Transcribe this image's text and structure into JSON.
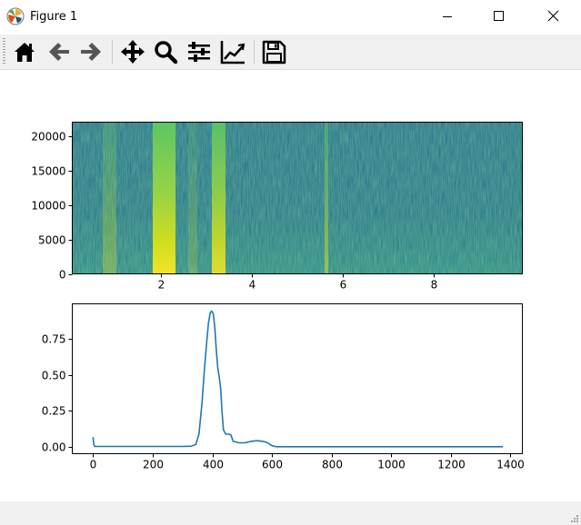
{
  "window": {
    "title": "Figure 1"
  },
  "toolbar": {
    "buttons": [
      {
        "id": "home",
        "icon": "home-icon"
      },
      {
        "id": "back",
        "icon": "arrow-left-icon"
      },
      {
        "id": "forward",
        "icon": "arrow-right-icon"
      },
      {
        "id": "pan",
        "icon": "move-icon"
      },
      {
        "id": "zoom",
        "icon": "magnifier-icon"
      },
      {
        "id": "subplots",
        "icon": "sliders-icon"
      },
      {
        "id": "customize",
        "icon": "line-chart-icon"
      },
      {
        "id": "save",
        "icon": "floppy-disk-icon"
      }
    ]
  },
  "colors": {
    "plot_line": "#1f77b4",
    "spec_bg": "#2a788e",
    "spec_hot": "#fde725"
  },
  "chart_data": [
    {
      "type": "heatmap",
      "xlim": [
        0.05,
        9.95
      ],
      "ylim": [
        0,
        22000
      ],
      "xticks": [
        2,
        4,
        6,
        8
      ],
      "xtick_labels": [
        "2",
        "4",
        "6",
        "8"
      ],
      "yticks": [
        0,
        5000,
        10000,
        15000,
        20000
      ],
      "ytick_labels": [
        "0",
        "5000",
        "10000",
        "15000",
        "20000"
      ],
      "colormap": "viridis",
      "bands": [
        {
          "x0": 1.82,
          "x1": 2.32,
          "intensity": 0.95
        },
        {
          "x0": 3.12,
          "x1": 3.42,
          "intensity": 0.85
        },
        {
          "x0": 5.6,
          "x1": 5.68,
          "intensity": 0.45
        },
        {
          "x0": 0.72,
          "x1": 1.02,
          "intensity": 0.3
        },
        {
          "x0": 2.6,
          "x1": 2.8,
          "intensity": 0.2
        }
      ]
    },
    {
      "type": "line",
      "xlim": [
        -70,
        1440
      ],
      "ylim": [
        -0.045,
        0.99
      ],
      "xticks": [
        0,
        200,
        400,
        600,
        800,
        1000,
        1200,
        1400
      ],
      "xtick_labels": [
        "0",
        "200",
        "400",
        "600",
        "800",
        "1000",
        "1200",
        "1400"
      ],
      "yticks": [
        0.0,
        0.25,
        0.5,
        0.75
      ],
      "ytick_labels": [
        "0.00",
        "0.25",
        "0.50",
        "0.75"
      ],
      "grid": false,
      "series": [
        {
          "x": [
            0,
            2,
            5,
            10,
            50,
            100,
            200,
            300,
            330,
            345,
            355,
            365,
            372,
            380,
            387,
            393,
            398,
            403,
            408,
            413,
            418,
            424,
            428,
            432,
            437,
            445,
            455,
            462,
            470,
            490,
            510,
            530,
            550,
            570,
            585,
            600,
            615,
            700,
            900,
            1100,
            1300,
            1375
          ],
          "y": [
            0.07,
            0.02,
            0.006,
            0.005,
            0.005,
            0.005,
            0.005,
            0.005,
            0.007,
            0.02,
            0.09,
            0.3,
            0.5,
            0.7,
            0.86,
            0.93,
            0.94,
            0.92,
            0.83,
            0.68,
            0.55,
            0.47,
            0.4,
            0.25,
            0.12,
            0.09,
            0.09,
            0.085,
            0.04,
            0.03,
            0.03,
            0.04,
            0.045,
            0.04,
            0.03,
            0.01,
            0.003,
            0.003,
            0.003,
            0.003,
            0.003,
            0.003
          ]
        }
      ]
    }
  ]
}
